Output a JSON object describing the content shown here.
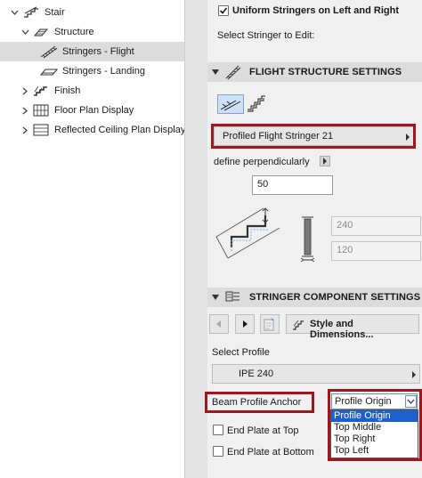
{
  "tree": {
    "items": [
      {
        "label": "Stair",
        "icon": "stair-icon",
        "expanded": true
      },
      {
        "label": "Structure",
        "icon": "structure-icon",
        "expanded": true
      },
      {
        "label": "Stringers - Flight",
        "icon": "stringer-flight-icon",
        "selected": true
      },
      {
        "label": "Stringers - Landing",
        "icon": "stringer-landing-icon"
      },
      {
        "label": "Finish",
        "icon": "finish-icon",
        "expanded": false
      },
      {
        "label": "Floor Plan Display",
        "icon": "floor-plan-icon",
        "expanded": false
      },
      {
        "label": "Reflected Ceiling Plan Display",
        "icon": "ceiling-plan-icon",
        "expanded": false
      }
    ]
  },
  "uniform_stringers": {
    "label": "Uniform Stringers on Left and Right",
    "checked": true
  },
  "select_stringer_label": "Select Stringer to Edit:",
  "flight_section": {
    "title": "FLIGHT STRUCTURE SETTINGS",
    "stringer_type": "Profiled Flight Stringer 21",
    "define_label": "define perpendicularly",
    "value_main": "50",
    "value_a": "240",
    "value_b": "120"
  },
  "component_section": {
    "title": "STRINGER COMPONENT SETTINGS",
    "style_button": "Style and Dimensions...",
    "select_profile_label": "Select Profile",
    "profile_value": "IPE 240",
    "anchor_label": "Beam Profile Anchor",
    "anchor_value": "Profile Origin",
    "anchor_options": [
      "Profile Origin",
      "Top Middle",
      "Top Right",
      "Top Left"
    ],
    "end_plate_top": "End Plate at Top",
    "end_plate_bottom": "End Plate at Bottom"
  },
  "colors": {
    "highlight_red": "#a3161c",
    "selection_blue": "#1e5fd0"
  }
}
